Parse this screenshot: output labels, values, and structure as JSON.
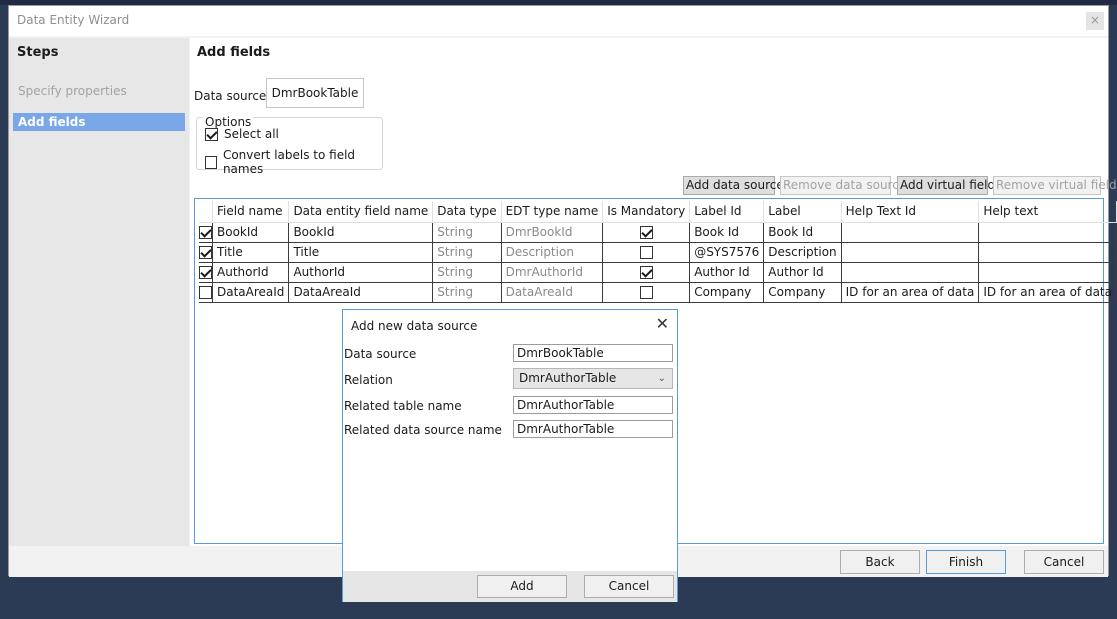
{
  "window": {
    "title": "Data Entity Wizard",
    "close_glyph": "×"
  },
  "steps": {
    "title": "Steps",
    "items": [
      {
        "label": "Specify properties",
        "state": "inactive"
      },
      {
        "label": "Add fields",
        "state": "active"
      }
    ]
  },
  "main": {
    "title": "Add fields",
    "data_source_label": "Data source",
    "data_source_value": "DmrBookTable",
    "options": {
      "legend": "Options",
      "select_all": {
        "label": "Select all",
        "checked": true
      },
      "convert_labels": {
        "label": "Convert labels to field names",
        "checked": false
      }
    },
    "toolbar": {
      "add_data_source": "Add data source",
      "remove_data_source": "Remove data source",
      "add_virtual_field": "Add virtual field",
      "remove_virtual_field": "Remove virtual field"
    },
    "grid": {
      "headers": [
        "",
        "Field name",
        "Data entity field name",
        "Data type",
        "EDT type name",
        "Is Mandatory",
        "Label Id",
        "Label",
        "Help Text Id",
        "Help text",
        ""
      ],
      "rows": [
        {
          "selected": true,
          "field_name": "BookId",
          "entity_field": "BookId",
          "data_type": "String",
          "edt": "DmrBookId",
          "mandatory": true,
          "label_id": "Book Id",
          "label": "Book Id",
          "help_text_id": "",
          "help_text": ""
        },
        {
          "selected": true,
          "field_name": "Title",
          "entity_field": "Title",
          "data_type": "String",
          "edt": "Description",
          "mandatory": false,
          "label_id": "@SYS7576",
          "label": "Description",
          "help_text_id": "",
          "help_text": ""
        },
        {
          "selected": true,
          "field_name": "AuthorId",
          "entity_field": "AuthorId",
          "data_type": "String",
          "edt": "DmrAuthorId",
          "mandatory": true,
          "label_id": "Author Id",
          "label": "Author Id",
          "help_text_id": "",
          "help_text": ""
        },
        {
          "selected": false,
          "field_name": "DataAreaId",
          "entity_field": "DataAreaId",
          "data_type": "String",
          "edt": "DataAreaId",
          "mandatory": false,
          "label_id": "Company",
          "label": "Company",
          "help_text_id": "ID for an area of data",
          "help_text": "ID for an area of data"
        }
      ]
    }
  },
  "footer": {
    "back": "Back",
    "finish": "Finish",
    "cancel": "Cancel"
  },
  "dialog": {
    "title": "Add new data source",
    "close_glyph": "✕",
    "fields": {
      "data_source": {
        "label": "Data source",
        "value": "DmrBookTable"
      },
      "relation": {
        "label": "Relation",
        "value": "DmrAuthorTable",
        "chevron": "⌄"
      },
      "related_table": {
        "label": "Related table name",
        "value": "DmrAuthorTable"
      },
      "related_ds": {
        "label": "Related data source name",
        "value": "DmrAuthorTable"
      }
    },
    "add": "Add",
    "cancel": "Cancel"
  }
}
